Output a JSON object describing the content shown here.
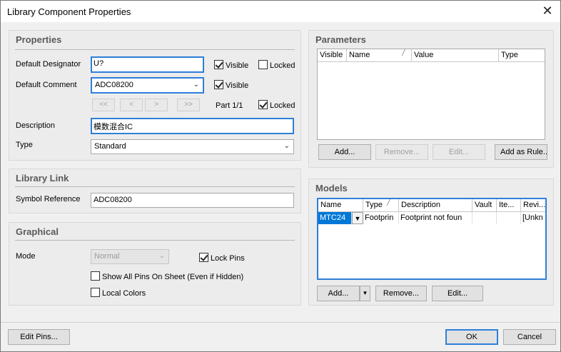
{
  "window": {
    "title": "Library Component Properties",
    "close_glyph": "✕"
  },
  "properties": {
    "title": "Properties",
    "designator_label": "Default Designator",
    "designator_value": "U?",
    "visible1_label": "Visible",
    "locked1_label": "Locked",
    "comment_label": "Default Comment",
    "comment_value": "ADC08200",
    "visible2_label": "Visible",
    "nav": [
      "<<",
      "<",
      ">",
      ">>"
    ],
    "part_label": "Part 1/1",
    "locked2_label": "Locked",
    "description_label": "Description",
    "description_value": "模数混合IC",
    "type_label": "Type",
    "type_value": "Standard"
  },
  "library_link": {
    "title": "Library Link",
    "symbol_ref_label": "Symbol Reference",
    "symbol_ref_value": "ADC08200"
  },
  "graphical": {
    "title": "Graphical",
    "mode_label": "Mode",
    "mode_value": "Normal",
    "lock_pins_label": "Lock Pins",
    "show_all_pins_label": "Show All Pins On Sheet (Even if Hidden)",
    "local_colors_label": "Local Colors"
  },
  "parameters": {
    "title": "Parameters",
    "columns": [
      "Visible",
      "Name",
      "Value",
      "Type"
    ],
    "buttons": {
      "add": "Add...",
      "remove": "Remove...",
      "edit": "Edit...",
      "add_as_rule": "Add as Rule..."
    }
  },
  "models": {
    "title": "Models",
    "columns": [
      "Name",
      "Type",
      "Description",
      "Vault",
      "Ite...",
      "Revi..."
    ],
    "rows": [
      {
        "name": "MTC24",
        "type": "Footprin",
        "description": "Footprint not foun",
        "vault": "",
        "item": "",
        "revision": "[Unkn"
      }
    ],
    "buttons": {
      "add": "Add...",
      "remove": "Remove...",
      "edit": "Edit..."
    }
  },
  "footer": {
    "edit_pins": "Edit Pins...",
    "ok": "OK",
    "cancel": "Cancel"
  }
}
